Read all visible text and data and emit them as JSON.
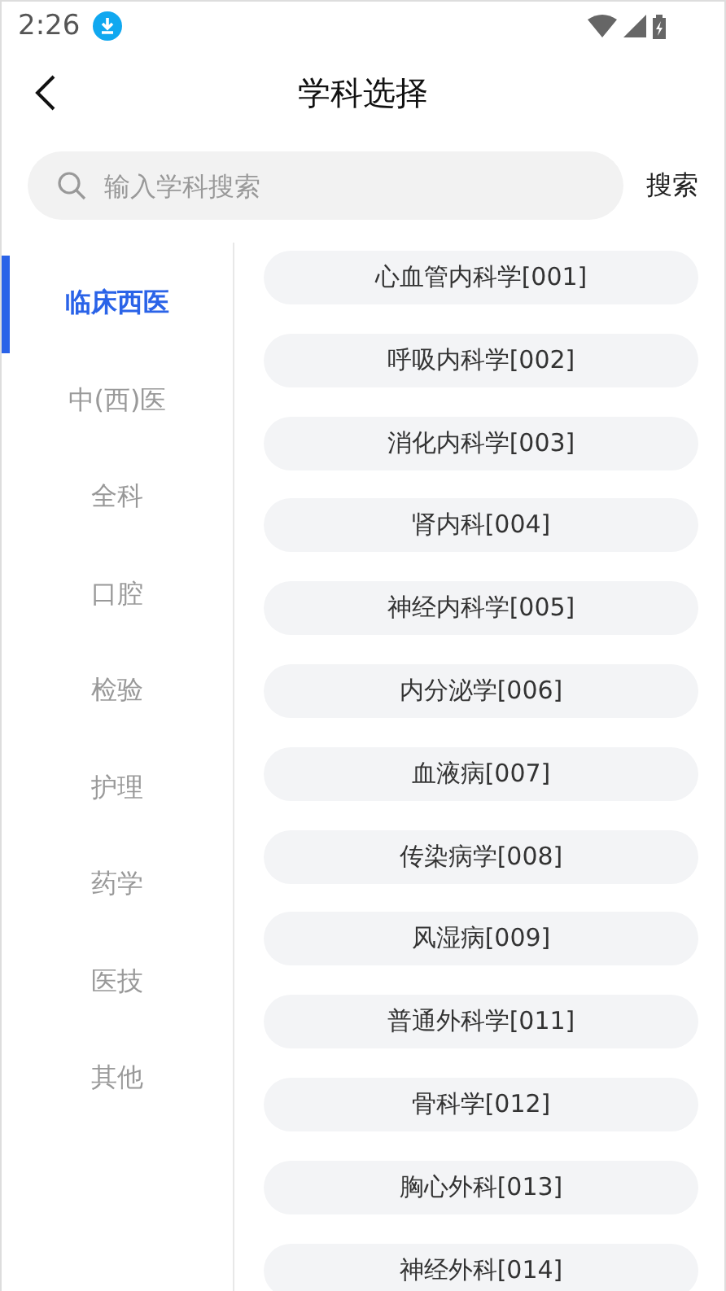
{
  "status_bar": {
    "time": "2:26"
  },
  "header": {
    "title": "学科选择"
  },
  "search": {
    "placeholder": "输入学科搜索",
    "button": "搜索"
  },
  "categories": [
    {
      "label": "临床西医",
      "selected": true
    },
    {
      "label": "中(西)医",
      "selected": false
    },
    {
      "label": "全科",
      "selected": false
    },
    {
      "label": "口腔",
      "selected": false
    },
    {
      "label": "检验",
      "selected": false
    },
    {
      "label": "护理",
      "selected": false
    },
    {
      "label": "药学",
      "selected": false
    },
    {
      "label": "医技",
      "selected": false
    },
    {
      "label": "其他",
      "selected": false
    }
  ],
  "subjects": [
    "心血管内科学[001]",
    "呼吸内科学[002]",
    "消化内科学[003]",
    "肾内科[004]",
    "神经内科学[005]",
    "内分泌学[006]",
    "血液病[007]",
    "传染病学[008]",
    "风湿病[009]",
    "普通外科学[011]",
    "骨科学[012]",
    "胸心外科[013]",
    "神经外科[014]"
  ]
}
